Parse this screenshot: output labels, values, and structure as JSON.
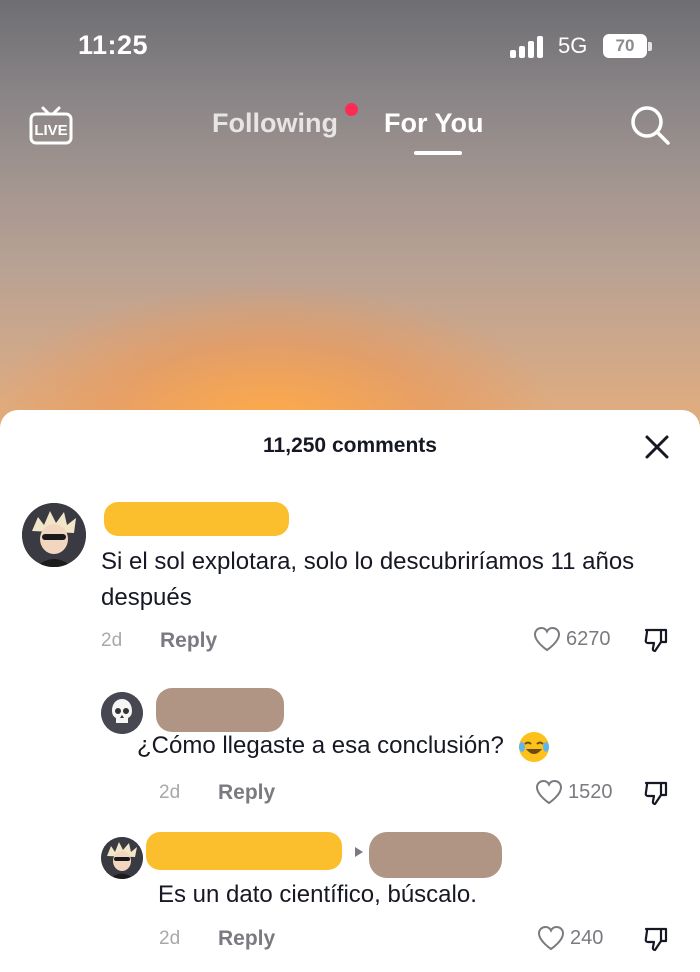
{
  "status_bar": {
    "time": "11:25",
    "network": "5G",
    "battery": "70"
  },
  "top_nav": {
    "following": "Following",
    "for_you": "For You",
    "live_icon": "live-tv-icon",
    "search_icon": "search-icon"
  },
  "comments_sheet": {
    "title": "11,250 comments",
    "comments": [
      {
        "text": "Si el sol explotara, solo lo descubriríamos 11 años después",
        "age": "2d",
        "reply_label": "Reply",
        "likes": "6270",
        "redaction_color": "#fbbf2e"
      },
      {
        "text": "¿Cómo llegaste a esa conclusión?",
        "emoji": "laughing-tears-emoji",
        "age": "2d",
        "reply_label": "Reply",
        "likes": "1520",
        "redaction_color": "#b09584"
      },
      {
        "text": "Es un dato científico, búscalo.",
        "age": "2d",
        "reply_label": "Reply",
        "likes": "240",
        "redaction_color": "#fbbf2e",
        "reply_to_redaction_color": "#b09584"
      }
    ]
  }
}
